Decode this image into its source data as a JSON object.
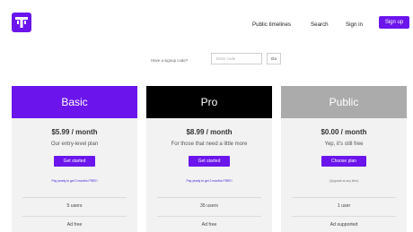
{
  "colors": {
    "accent": "#6b15ec",
    "pro_header": "#000000",
    "public_header": "#ababab",
    "card_bg": "#f2f2f2"
  },
  "header": {
    "logo_icon": "tootle-t-logo-icon",
    "nav": {
      "public_timelines": "Public timelines",
      "search": "Search",
      "sign_in": "Sign in"
    },
    "signup_label": "Sign up"
  },
  "signup_code": {
    "label": "Have a signup code?",
    "placeholder": "Enter code",
    "go_label": "Go"
  },
  "plans": [
    {
      "name": "Basic",
      "price": "$5.99 / month",
      "description": "Our entry-level plan",
      "cta": "Get started",
      "note": "Pay yearly to get 2 months FREE!",
      "users": "5 users",
      "ads": "Ad free"
    },
    {
      "name": "Pro",
      "price": "$8.99 / month",
      "description": "For those that need a little more",
      "cta": "Get started",
      "note": "Pay yearly to get 2 months FREE!",
      "users": "35 users",
      "ads": "Ad free"
    },
    {
      "name": "Public",
      "price": "$0.00 / month",
      "description": "Yep, it's still free",
      "cta": "Choose plan",
      "note": "(Upgrade at any time)",
      "users": "1 user",
      "ads": "Ad supported"
    }
  ]
}
